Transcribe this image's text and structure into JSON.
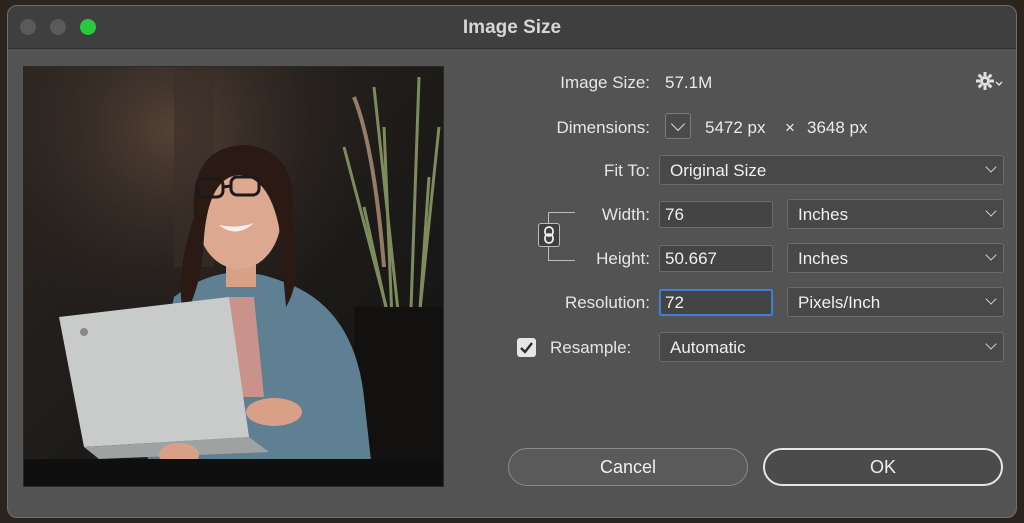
{
  "window": {
    "title": "Image Size"
  },
  "image_size": {
    "label": "Image Size:",
    "value": "57.1M"
  },
  "dimensions": {
    "label": "Dimensions:",
    "width": "5472 px",
    "times": "×",
    "height": "3648 px"
  },
  "fit_to": {
    "label": "Fit To:",
    "value": "Original Size"
  },
  "width": {
    "label": "Width:",
    "value": "76",
    "unit": "Inches"
  },
  "height": {
    "label": "Height:",
    "value": "50.667",
    "unit": "Inches"
  },
  "resolution": {
    "label": "Resolution:",
    "value": "72",
    "unit": "Pixels/Inch"
  },
  "resample": {
    "label": "Resample:",
    "checked": true,
    "value": "Automatic"
  },
  "buttons": {
    "cancel": "Cancel",
    "ok": "OK"
  },
  "colors": {
    "close": "#555555",
    "minimize": "#555555",
    "zoom": "#27c93f",
    "focus": "#3f7fd2"
  },
  "icons": {
    "settings": "gear-icon",
    "link": "chain-link-icon",
    "checkbox": "checkmark-icon"
  }
}
